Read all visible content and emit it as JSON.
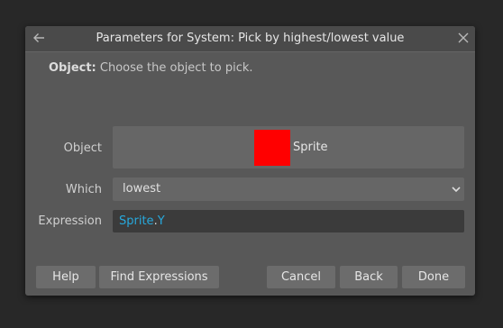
{
  "dialog": {
    "title": "Parameters for System: Pick by highest/lowest value",
    "description": {
      "param_name": "Object:",
      "text": "Choose the object to pick."
    }
  },
  "params": {
    "object": {
      "label": "Object",
      "value": "Sprite",
      "swatch_color": "#ff0000"
    },
    "which": {
      "label": "Which",
      "value": "lowest"
    },
    "expression": {
      "label": "Expression",
      "object": "Sprite",
      "dot": ".",
      "member": "Y"
    }
  },
  "buttons": {
    "help": "Help",
    "find_expressions": "Find Expressions",
    "cancel": "Cancel",
    "back": "Back",
    "done": "Done"
  },
  "colors": {
    "expression_token": "#27a9dd",
    "dialog_bg": "#585858",
    "button_bg": "#6c6c6c"
  }
}
